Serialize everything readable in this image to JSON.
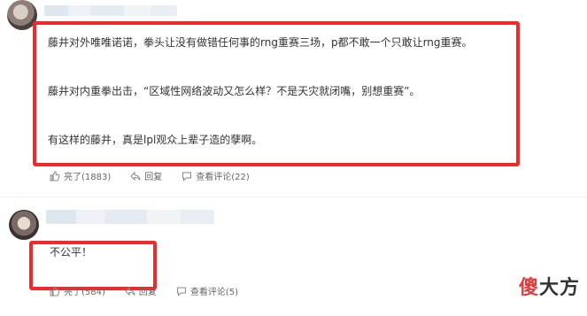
{
  "comments": [
    {
      "paragraphs": [
        "藤井对外唯唯诺诺，拳头让没有做错任何事的rng重赛三场，p都不敢一个只敢让rng重赛。",
        "藤井对内重拳出击，“区域性网络波动又怎么样？不是天灾就闭嘴，别想重赛”。",
        "有这样的藤井，真是lpl观众上辈子造的孽啊。"
      ],
      "actions": {
        "like": "亮了(1883)",
        "reply": "回复",
        "view": "查看评论(22)"
      }
    },
    {
      "paragraphs": [
        "不公平！"
      ],
      "actions": {
        "like": "亮了(584)",
        "reply": "回复",
        "view": "查看评论(5)"
      }
    }
  ],
  "watermark": {
    "part1": "傻",
    "part2": "大方"
  },
  "colors": {
    "highlight": "#f02a2a",
    "text": "#333333",
    "muted": "#666666"
  }
}
